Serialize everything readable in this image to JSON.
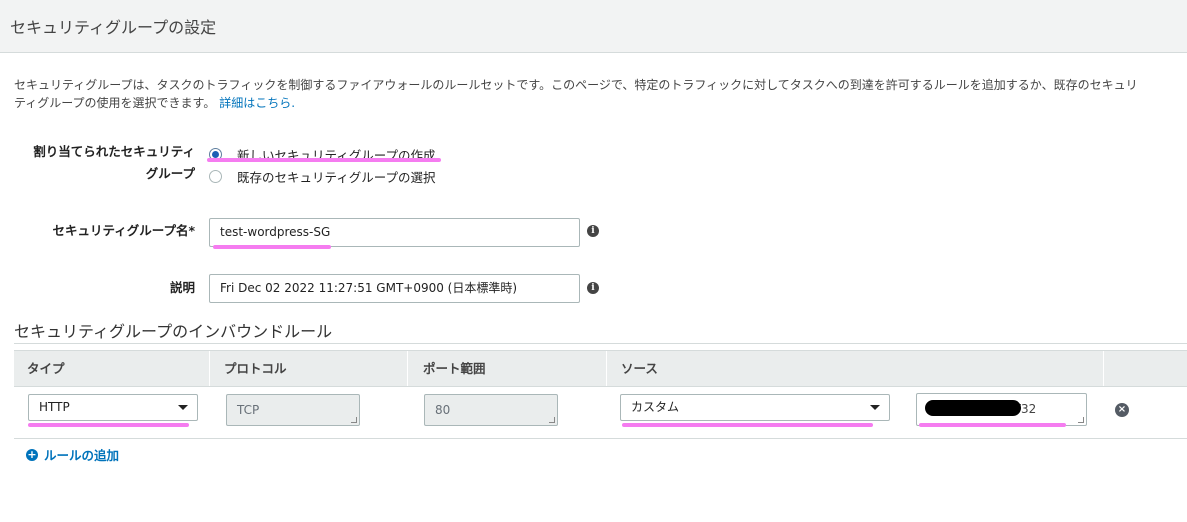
{
  "header": {
    "title": "セキュリティグループの設定"
  },
  "intro": {
    "line1": "セキュリティグループは、タスクのトラフィックを制御するファイアウォールのルールセットです。このページで、特定のトラフィックに対してタスクへの到達を許可するルールを追加するか、既存のセキュリ",
    "line2": "ティグループの使用を選択できます。",
    "link": "詳細はこちら."
  },
  "assigned_group": {
    "label_line1": "割り当てられたセキュリティ",
    "label_line2": "グループ",
    "options": [
      {
        "label": "新しいセキュリティグループの作成",
        "checked": true
      },
      {
        "label": "既存のセキュリティグループの選択",
        "checked": false
      }
    ]
  },
  "group_name": {
    "label": "セキュリティグループ名*",
    "value": "test-wordpress-SG",
    "info_icon": "info-icon"
  },
  "description": {
    "label": "説明",
    "value": "Fri Dec 02 2022 11:27:51 GMT+0900 (日本標準時)",
    "info_icon": "info-icon"
  },
  "inbound": {
    "title": "セキュリティグループのインバウンドルール",
    "columns": [
      "タイプ",
      "プロトコル",
      "ポート範囲",
      "ソース"
    ],
    "rows": [
      {
        "type": "HTTP",
        "protocol": "TCP",
        "port": "80",
        "source_type": "カスタム",
        "source_cidr_suffix": "/32"
      }
    ],
    "add_rule_label": "ルールの追加"
  },
  "colors": {
    "highlight": "#f57cf0",
    "link": "#0073bb",
    "radio": "#1a5fb4"
  }
}
